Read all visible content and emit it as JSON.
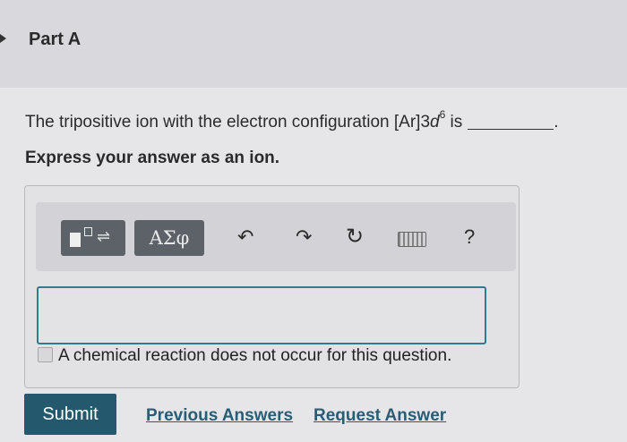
{
  "part": {
    "title": "Part A"
  },
  "question": {
    "text_before": "The tripositive ion with the electron configuration [Ar]3",
    "orbital": "d",
    "superscript": "6",
    "text_after": " is",
    "end_punct": "."
  },
  "instruction": "Express your answer as an ion.",
  "toolbar": {
    "templates_icon": "templates-icon",
    "greek_label": "ΑΣφ",
    "undo_icon": "undo-icon",
    "redo_icon": "redo-icon",
    "reset_icon": "reset-icon",
    "keyboard_icon": "keyboard-icon",
    "help_label": "?"
  },
  "answer": {
    "value": ""
  },
  "checkbox": {
    "label": "A chemical reaction does not occur for this question.",
    "checked": false
  },
  "actions": {
    "submit_label": "Submit",
    "previous_answers_label": "Previous Answers",
    "request_answer_label": "Request Answer"
  },
  "colors": {
    "accent": "#24586d",
    "link": "#2a5d73",
    "input_border": "#2f7d8c"
  }
}
